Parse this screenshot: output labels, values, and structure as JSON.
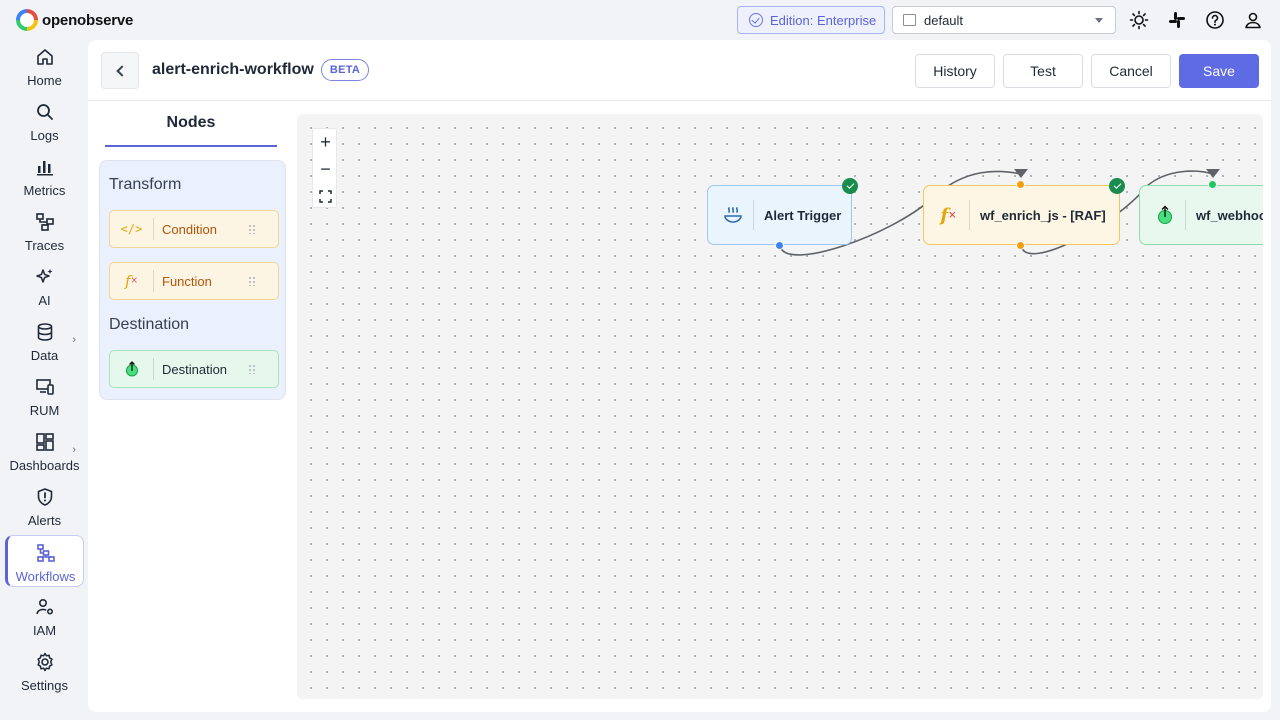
{
  "app": {
    "brand": "openobserve"
  },
  "topbar": {
    "edition_label": "Edition: Enterprise",
    "org_selected": "default",
    "icons": [
      "theme-toggle-icon",
      "slack-icon",
      "help-icon",
      "user-icon"
    ]
  },
  "sidebar": {
    "items": [
      {
        "label": "Home",
        "icon": "home-icon"
      },
      {
        "label": "Logs",
        "icon": "search-icon"
      },
      {
        "label": "Metrics",
        "icon": "bar-chart-icon"
      },
      {
        "label": "Traces",
        "icon": "traces-icon"
      },
      {
        "label": "AI",
        "icon": "sparkles-icon"
      },
      {
        "label": "Data",
        "icon": "database-icon"
      },
      {
        "label": "RUM",
        "icon": "devices-icon"
      },
      {
        "label": "Dashboards",
        "icon": "dashboard-icon"
      },
      {
        "label": "Alerts",
        "icon": "alert-shield-icon"
      },
      {
        "label": "Workflows",
        "icon": "workflow-icon",
        "active": true
      },
      {
        "label": "IAM",
        "icon": "users-gear-icon"
      },
      {
        "label": "Settings",
        "icon": "gear-icon"
      }
    ]
  },
  "header": {
    "title": "alert-enrich-workflow",
    "badge": "BETA",
    "history_label": "History",
    "test_label": "Test",
    "cancel_label": "Cancel",
    "save_label": "Save"
  },
  "nodes_panel": {
    "tab_label": "Nodes",
    "transform_title": "Transform",
    "transform_items": [
      {
        "label": "Condition",
        "icon": "code-icon"
      },
      {
        "label": "Function",
        "icon": "function-icon"
      }
    ],
    "destination_title": "Destination",
    "destination_items": [
      {
        "label": "Destination",
        "icon": "upload-icon"
      }
    ]
  },
  "canvas": {
    "zoom_in_label": "+",
    "zoom_out_label": "−",
    "nodes": [
      {
        "label": "Alert Trigger",
        "type": "trigger",
        "status": "valid"
      },
      {
        "label": "wf_enrich_js - [RAF]",
        "type": "function",
        "status": "valid"
      },
      {
        "label": "wf_webhoo",
        "type": "destination"
      }
    ],
    "colors": {
      "trigger": "#3b82f6",
      "function": "#f59e0b",
      "destination": "#22c55e",
      "valid": "#1a8d4e"
    }
  }
}
